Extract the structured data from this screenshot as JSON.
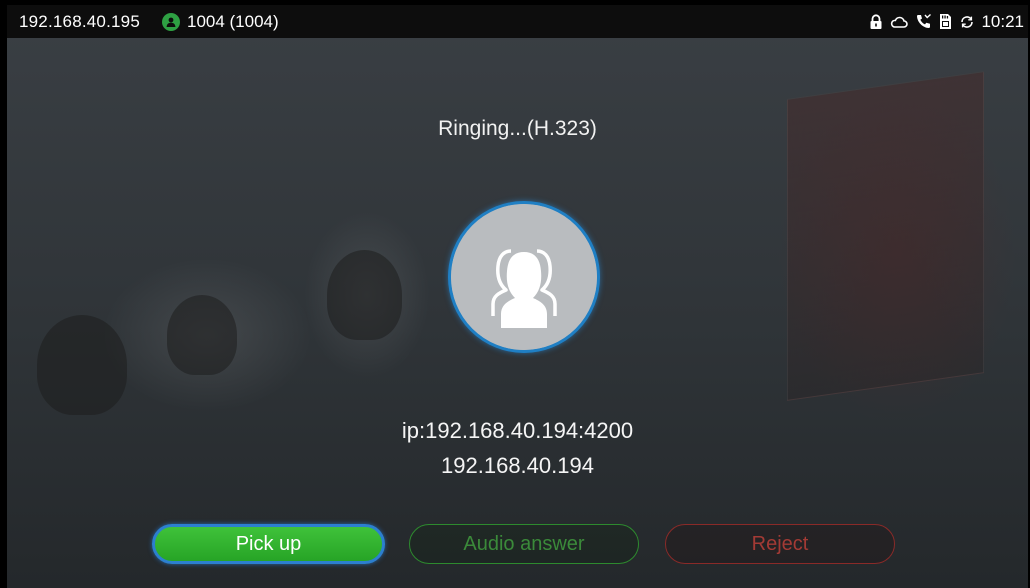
{
  "status_bar": {
    "ip_address": "192.168.40.195",
    "account_label": "1004 (1004)",
    "account_icon": "account-icon",
    "account_color": "#2ea043",
    "icons": [
      "lock-icon",
      "cloud-icon",
      "phone-missed-icon",
      "sd-card-icon",
      "sync-icon"
    ],
    "time": "10:21"
  },
  "call": {
    "status": "Ringing...(H.323)",
    "caller_ip": "ip:192.168.40.194:4200",
    "caller_number": "192.168.40.194",
    "avatar_icon": "group-contacts-icon",
    "avatar_ring_color": "#1f7fc4"
  },
  "actions": {
    "pickup_label": "Pick up",
    "audio_answer_label": "Audio answer",
    "reject_label": "Reject",
    "pickup_color": "#34b52f",
    "audio_color": "#2d8a2e",
    "reject_color": "#8a2a28"
  }
}
